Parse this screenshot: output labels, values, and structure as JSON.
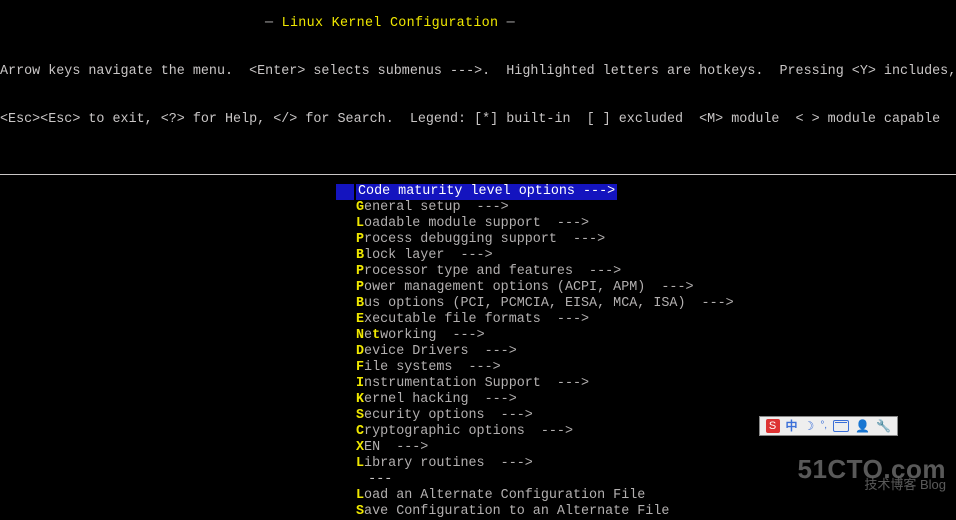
{
  "title": "Linux Kernel Configuration",
  "help_lines": [
    "Arrow keys navigate the menu.  <Enter> selects submenus --->.  Highlighted letters are hotkeys.  Pressing <Y> includes, <N> excludes, <M>",
    "<Esc><Esc> to exit, <?> for Help, </> for Search.  Legend: [*] built-in  [ ] excluded  <M> module  < > module capable"
  ],
  "selected_index": 0,
  "menu": [
    {
      "hotkey": "C",
      "rest": "ode maturity level options  --->"
    },
    {
      "hotkey": "G",
      "rest": "eneral setup  --->"
    },
    {
      "hotkey": "L",
      "rest": "oadable module support  --->"
    },
    {
      "hotkey": "P",
      "rest": "rocess debugging support  --->"
    },
    {
      "hotkey": "B",
      "rest": "lock layer  --->"
    },
    {
      "hotkey": "P",
      "rest": "rocessor type and features  --->"
    },
    {
      "hotkey": "P",
      "rest": "ower management options (ACPI, APM)  --->"
    },
    {
      "hotkey": "B",
      "rest": "us options (PCI, PCMCIA, EISA, MCA, ISA)  --->"
    },
    {
      "hotkey": "E",
      "rest": "xecutable file formats  --->"
    },
    {
      "hotkey": "N",
      "rest": "e",
      "extra_hotkey": "t",
      "extra_rest": "working  --->"
    },
    {
      "hotkey": "D",
      "rest": "evice Drivers  --->"
    },
    {
      "hotkey": "F",
      "rest": "ile systems  --->"
    },
    {
      "hotkey": "I",
      "rest": "nstrumentation Support  --->"
    },
    {
      "hotkey": "K",
      "rest": "ernel hacking  --->"
    },
    {
      "hotkey": "S",
      "rest": "ecurity options  --->"
    },
    {
      "hotkey": "C",
      "rest": "ryptographic options  --->"
    },
    {
      "hotkey": "X",
      "rest": "EN  --->"
    },
    {
      "hotkey": "L",
      "rest": "ibrary routines  --->"
    }
  ],
  "separator": "---",
  "actions": [
    {
      "hotkey": "L",
      "rest": "oad an Alternate Configuration File"
    },
    {
      "hotkey": "S",
      "rest": "ave Configuration to an Alternate File"
    }
  ],
  "watermark": {
    "site": "51CTO.com",
    "sub": "技术博客    Blog"
  },
  "tray": {
    "ch": "中"
  }
}
